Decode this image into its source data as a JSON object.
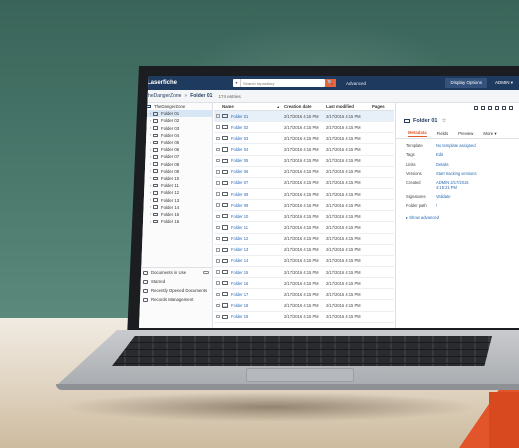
{
  "app": {
    "brand": "Laserfiche",
    "search_placeholder": "Search repository",
    "search_scope": "▾",
    "search_button": "🔍",
    "advanced": "Advanced",
    "display_options": "Display Options",
    "user": "ADMIN ▾"
  },
  "breadcrumb": {
    "root": "TheDangerZone",
    "separator": "»",
    "current": "Folder 01",
    "count": "174 entries"
  },
  "tree": {
    "root": "TheDangerZone",
    "items": [
      "Folder 01",
      "Folder 02",
      "Folder 03",
      "Folder 04",
      "Folder 05",
      "Folder 06",
      "Folder 07",
      "Folder 08",
      "Folder 09",
      "Folder 10",
      "Folder 11",
      "Folder 12",
      "Folder 13",
      "Folder 14",
      "Folder 15",
      "Folder 16"
    ],
    "shortcuts": [
      "Documents in Use",
      "Starred",
      "Recently Opened Documents",
      "Records Management"
    ]
  },
  "list": {
    "headers": {
      "name": "Name",
      "created": "Creation date",
      "modified": "Last modified",
      "pages": "Pages"
    },
    "rows": [
      {
        "name": "Folder 01",
        "created": "2/17/2016 4:15 PM",
        "modified": "2/17/2016 4:15 PM",
        "kind": "folder"
      },
      {
        "name": "Folder 02",
        "created": "2/17/2016 4:15 PM",
        "modified": "2/17/2016 4:15 PM",
        "kind": "folder"
      },
      {
        "name": "Folder 03",
        "created": "2/17/2016 4:15 PM",
        "modified": "2/17/2016 4:15 PM",
        "kind": "folder"
      },
      {
        "name": "Folder 04",
        "created": "2/17/2016 4:15 PM",
        "modified": "2/17/2016 4:15 PM",
        "kind": "folder"
      },
      {
        "name": "Folder 05",
        "created": "2/17/2016 4:15 PM",
        "modified": "2/17/2016 4:15 PM",
        "kind": "folder"
      },
      {
        "name": "Folder 06",
        "created": "2/17/2016 4:15 PM",
        "modified": "2/17/2016 4:15 PM",
        "kind": "folder"
      },
      {
        "name": "Folder 07",
        "created": "2/17/2016 4:15 PM",
        "modified": "2/17/2016 4:15 PM",
        "kind": "folder"
      },
      {
        "name": "Folder 08",
        "created": "2/17/2016 4:15 PM",
        "modified": "2/17/2016 4:15 PM",
        "kind": "doc"
      },
      {
        "name": "Folder 09",
        "created": "2/17/2016 4:15 PM",
        "modified": "2/17/2016 4:15 PM",
        "kind": "doc"
      },
      {
        "name": "Folder 10",
        "created": "2/17/2016 4:15 PM",
        "modified": "2/17/2016 4:15 PM",
        "kind": "doc"
      },
      {
        "name": "Folder 11",
        "created": "2/17/2016 4:15 PM",
        "modified": "2/17/2016 4:15 PM",
        "kind": "folder"
      },
      {
        "name": "Folder 12",
        "created": "2/17/2016 4:15 PM",
        "modified": "2/17/2016 4:15 PM",
        "kind": "doc"
      },
      {
        "name": "Folder 13",
        "created": "2/17/2016 4:15 PM",
        "modified": "2/17/2016 4:15 PM",
        "kind": "doc"
      },
      {
        "name": "Folder 14",
        "created": "2/17/2016 4:15 PM",
        "modified": "2/17/2016 4:15 PM",
        "kind": "doc"
      },
      {
        "name": "Folder 15",
        "created": "2/17/2016 4:15 PM",
        "modified": "2/17/2016 4:15 PM",
        "kind": "folder"
      },
      {
        "name": "Folder 16",
        "created": "2/17/2016 4:15 PM",
        "modified": "2/17/2016 4:15 PM",
        "kind": "folder"
      },
      {
        "name": "Folder 17",
        "created": "2/17/2016 4:15 PM",
        "modified": "2/17/2016 4:15 PM",
        "kind": "doc"
      },
      {
        "name": "Folder 18",
        "created": "2/17/2016 4:15 PM",
        "modified": "2/17/2016 4:15 PM",
        "kind": "doc"
      },
      {
        "name": "Folder 19",
        "created": "2/17/2016 4:15 PM",
        "modified": "2/17/2016 4:15 PM",
        "kind": "doc"
      }
    ]
  },
  "meta": {
    "title": "Folder 01",
    "star": "☆",
    "tabs": [
      "Metadata",
      "Fields",
      "Preview",
      "More ▾"
    ],
    "rows": [
      {
        "k": "Template",
        "v": "No template assigned"
      },
      {
        "k": "Tags",
        "v": "Edit"
      },
      {
        "k": "Links",
        "v": "Details"
      },
      {
        "k": "Versions",
        "v": "Start tracking versions"
      },
      {
        "k": "Created",
        "v": "ADMIN 2/17/2016 4:15:21 PM"
      },
      {
        "k": "Signatures",
        "v": "Validate"
      },
      {
        "k": "Folder path",
        "v": "\\"
      }
    ],
    "show_advanced": "▸ Show advanced"
  },
  "colors": {
    "topbar": "#1f3a5f",
    "accent": "#e8643c",
    "link": "#2a6ab4",
    "wall": "#4b7a6d",
    "desk": "#e3d8c7"
  }
}
